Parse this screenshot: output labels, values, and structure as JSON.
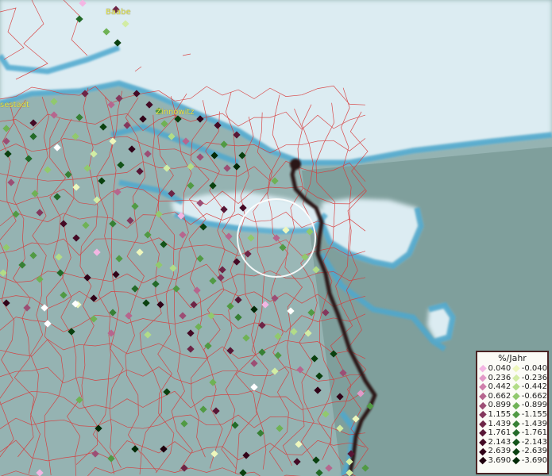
{
  "map": {
    "place_labels": [
      "Baabe",
      "Zinnowitz",
      "sestadt"
    ],
    "colors": {
      "land": "#95b3b2",
      "sea": "#dcecf2",
      "coast_water": "#4ea8cf",
      "borders": "#d83a3a",
      "track": "#2a1414"
    }
  },
  "legend": {
    "title": "%/Jahr",
    "positive": [
      {
        "value": "0.040",
        "color": "#f3b6e3"
      },
      {
        "value": "0.236",
        "color": "#e29ac8"
      },
      {
        "value": "0.442",
        "color": "#cf7fab"
      },
      {
        "value": "0.662",
        "color": "#b6668e"
      },
      {
        "value": "0.899",
        "color": "#9c4e74"
      },
      {
        "value": "1.155",
        "color": "#84375c"
      },
      {
        "value": "1.439",
        "color": "#6d2546"
      },
      {
        "value": "1.761",
        "color": "#581635"
      },
      {
        "value": "2.143",
        "color": "#440a25"
      },
      {
        "value": "2.639",
        "color": "#310318"
      },
      {
        "value": "3.690",
        "color": "#1f000d"
      }
    ],
    "negative": [
      {
        "value": "-0.040",
        "color": "#eef7bd"
      },
      {
        "value": "-0.236",
        "color": "#d2eca4"
      },
      {
        "value": "-0.442",
        "color": "#b2dc87"
      },
      {
        "value": "-0.662",
        "color": "#91c96d"
      },
      {
        "value": "-0.899",
        "color": "#6fb255"
      },
      {
        "value": "-1.155",
        "color": "#519a44"
      },
      {
        "value": "-1.439",
        "color": "#378035"
      },
      {
        "value": "-1.761",
        "color": "#236a28"
      },
      {
        "value": "-2.143",
        "color": "#145419"
      },
      {
        "value": "-2.639",
        "color": "#0a400f"
      },
      {
        "value": "-3.690",
        "color": "#032a07"
      }
    ]
  }
}
